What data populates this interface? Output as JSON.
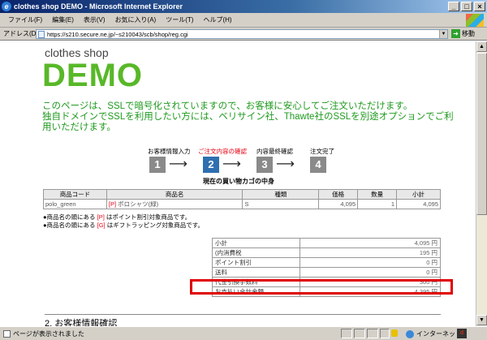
{
  "window": {
    "title": "clothes shop DEMO - Microsoft Internet Explorer",
    "controls": [
      "_",
      "□",
      "×"
    ]
  },
  "menubar": {
    "items": [
      "ファイル(F)",
      "編集(E)",
      "表示(V)",
      "お気に入り(A)",
      "ツール(T)",
      "ヘルプ(H)"
    ]
  },
  "addressbar": {
    "label": "アドレス(D)",
    "url": "https://s210.secure.ne.jp/~s210043/scb/shop/reg.cgi",
    "go_label": "移動"
  },
  "page": {
    "logo_small": "clothes shop",
    "logo_big": "DEMO",
    "notice_line1": "このページは、SSLで暗号化されていますので、お客様に安心してご注文いただけます。",
    "notice_line2": "独自ドメインでSSLを利用したい方には、ベリサイン社、Thawte社のSSLを別途オプションでご利",
    "notice_line3": "用いただけます。",
    "steps": [
      {
        "label": "お客様情報入力",
        "number": "1"
      },
      {
        "label": "ご注文内容の確認",
        "number": "2"
      },
      {
        "label": "内容最終確認",
        "number": "3"
      },
      {
        "label": "注文完了",
        "number": "4"
      }
    ],
    "current_step_index": 1,
    "cart_caption": "現在の買い物カゴの中身",
    "cart": {
      "headers": [
        "商品コード",
        "商品名",
        "種類",
        "価格",
        "数量",
        "小計"
      ],
      "rows": [
        {
          "code": "polo_green",
          "mark": "[P]",
          "name": "ポロシャツ(緑)",
          "kind": "S",
          "price": "4,095",
          "qty": "1",
          "subtotal": "4,095"
        }
      ]
    },
    "notes": [
      {
        "prefix": "●商品名の頭にある",
        "mark": "[P]",
        "suffix": "はポイント割引対象商品です。"
      },
      {
        "prefix": "●商品名の頭にある",
        "mark": "[G]",
        "suffix": "はギフトラッピング対象商品です。"
      }
    ],
    "totals": [
      {
        "label": "小計",
        "value": "4,095 円"
      },
      {
        "label": "(内消費税",
        "value": "195 円"
      },
      {
        "label": "ポイント割引",
        "value": "0 円"
      },
      {
        "label": "送料",
        "value": "0 円"
      },
      {
        "label": "代金引換手数料",
        "value": "300 円"
      },
      {
        "label": "お支払い合計金額",
        "value": "4,395 円"
      }
    ],
    "section2_title": "2. お客様情報確認"
  },
  "statusbar": {
    "text": "ページが表示されました",
    "zone": "インターネット"
  },
  "colors": {
    "brand_green": "#58b828",
    "notice_green": "#1f9a1f",
    "active_step": "#e60012",
    "highlight": "#e00000",
    "titlebar": "#0a246a"
  }
}
